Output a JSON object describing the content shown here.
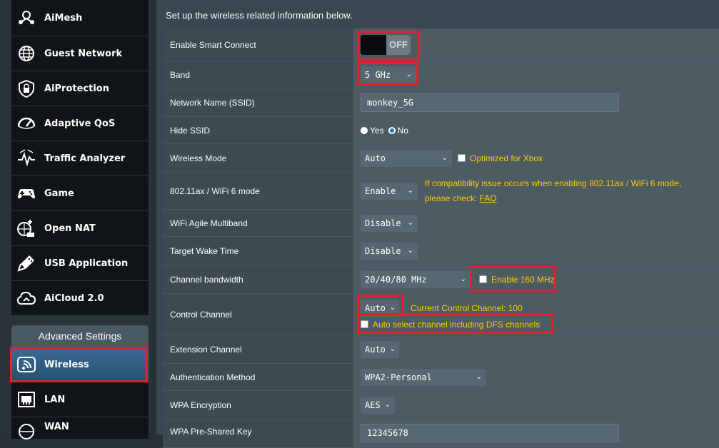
{
  "sidebar": {
    "items": [
      {
        "label": "AiMesh",
        "icon": "aimesh-icon"
      },
      {
        "label": "Guest Network",
        "icon": "globe-icon"
      },
      {
        "label": "AiProtection",
        "icon": "shield-lock-icon"
      },
      {
        "label": "Adaptive QoS",
        "icon": "speedometer-icon"
      },
      {
        "label": "Traffic Analyzer",
        "icon": "traffic-icon"
      },
      {
        "label": "Game",
        "icon": "gamepad-icon"
      },
      {
        "label": "Open NAT",
        "icon": "open-nat-icon"
      },
      {
        "label": "USB Application",
        "icon": "usb-icon"
      },
      {
        "label": "AiCloud 2.0",
        "icon": "cloud-icon"
      }
    ],
    "advanced_header": "Advanced Settings",
    "wireless_label": "Wireless",
    "lan_label": "LAN",
    "wan_label": "WAN"
  },
  "main": {
    "intro": "Set up the wireless related information below.",
    "rows": {
      "smart_connect": {
        "label": "Enable Smart Connect",
        "toggle": "OFF"
      },
      "band": {
        "label": "Band",
        "value": "5 GHz"
      },
      "ssid": {
        "label": "Network Name (SSID)",
        "value": "monkey_5G"
      },
      "hide_ssid": {
        "label": "Hide SSID",
        "yes": "Yes",
        "no": "No"
      },
      "wireless_mode": {
        "label": "Wireless Mode",
        "value": "Auto",
        "checkbox": "Optimized for Xbox"
      },
      "ax_mode": {
        "label": "802.11ax / WiFi 6 mode",
        "value": "Enable",
        "note_line1": "If compatibility issue occurs when enabling 802.11ax / WiFi 6 mode,",
        "note_line2": "please check:",
        "note_link": "FAQ"
      },
      "agile": {
        "label": "WiFi Agile Multiband",
        "value": "Disable"
      },
      "twt": {
        "label": "Target Wake Time",
        "value": "Disable"
      },
      "bandwidth": {
        "label": "Channel bandwidth",
        "value": "20/40/80 MHz",
        "checkbox": "Enable 160 MHz"
      },
      "control_channel": {
        "label": "Control Channel",
        "value": "Auto",
        "current": "Current Control Channel: 100",
        "checkbox": "Auto select channel including DFS channels"
      },
      "extension": {
        "label": "Extension Channel",
        "value": "Auto"
      },
      "auth": {
        "label": "Authentication Method",
        "value": "WPA2-Personal"
      },
      "encryption": {
        "label": "WPA Encryption",
        "value": "AES"
      },
      "psk": {
        "label": "WPA Pre-Shared Key",
        "value": "12345678"
      }
    }
  },
  "colors": {
    "highlight": "#e0222b",
    "note": "#ffcc00",
    "active_nav": "#3c6b93"
  }
}
